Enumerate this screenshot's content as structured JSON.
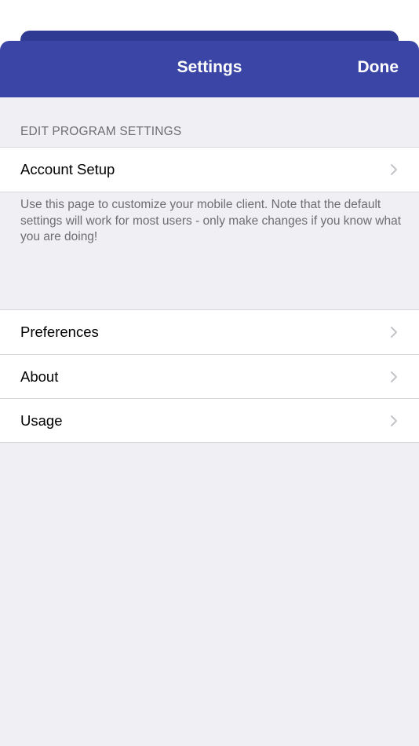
{
  "navbar": {
    "title": "Settings",
    "done_label": "Done"
  },
  "sections": {
    "program": {
      "header": "EDIT PROGRAM SETTINGS",
      "items": [
        {
          "label": "Account Setup",
          "icon": "chevron-right-icon"
        }
      ],
      "footer": "Use this page to customize your mobile client. Note that the default settings will work for most users - only make changes if you know what you are doing!"
    },
    "general": {
      "items": [
        {
          "label": "Preferences",
          "icon": "chevron-right-icon"
        },
        {
          "label": "About",
          "icon": "chevron-right-icon"
        },
        {
          "label": "Usage",
          "icon": "chevron-right-icon"
        }
      ]
    }
  },
  "colors": {
    "navbar": "#3a45a5",
    "background": "#efeff4",
    "secondary_text": "#6d6d72",
    "chevron": "#c4c4c9"
  }
}
